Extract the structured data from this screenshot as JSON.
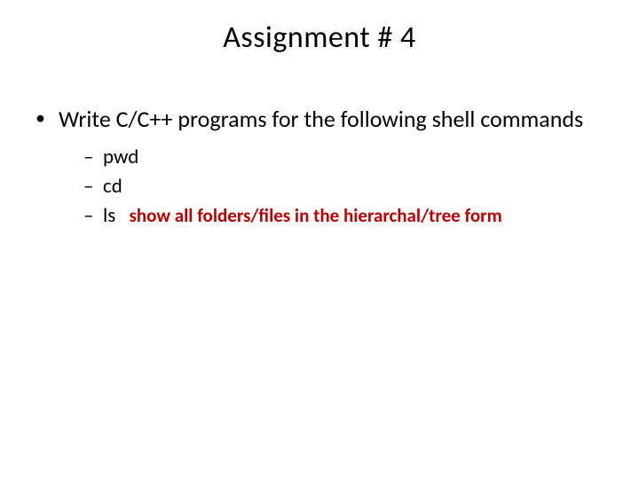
{
  "title": "Assignment # 4",
  "main_bullet": "Write C/C++ programs for the following shell commands",
  "items": [
    {
      "label": "pwd",
      "note": ""
    },
    {
      "label": "cd",
      "note": ""
    },
    {
      "label": "ls",
      "note": "show all folders/files in the hierarchal/tree form"
    }
  ],
  "glyphs": {
    "bullet": "•",
    "dash": "–"
  },
  "colors": {
    "note": "#c00000",
    "text": "#000000",
    "background": "#ffffff"
  }
}
